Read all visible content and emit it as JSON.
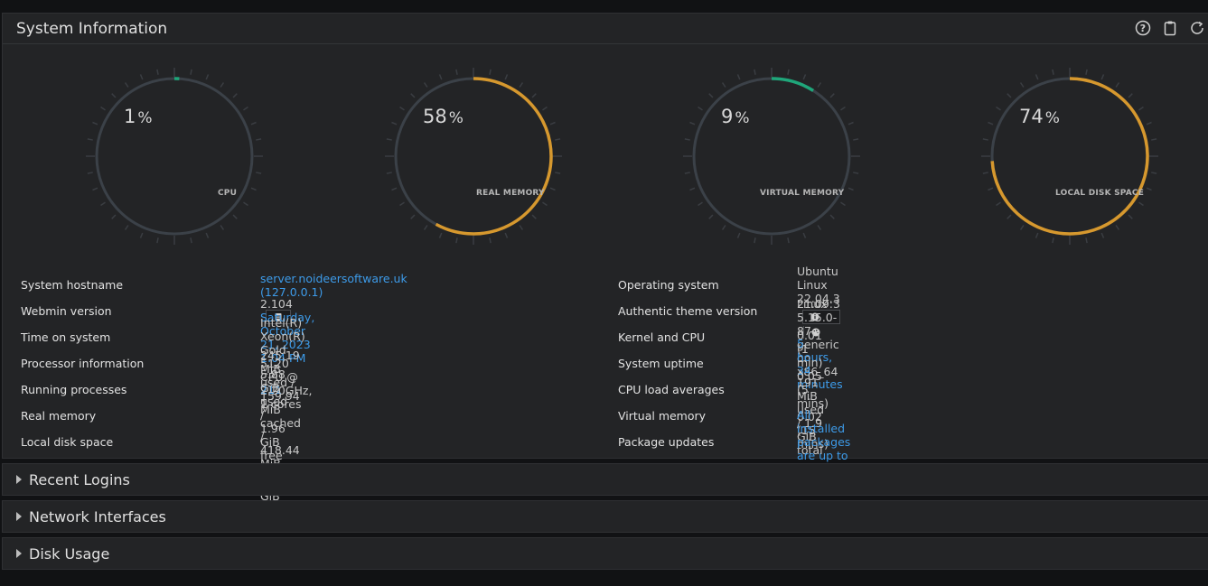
{
  "panel": {
    "title": "System Information",
    "icons": [
      "help-icon",
      "clipboard-icon",
      "refresh-icon"
    ]
  },
  "gauges": [
    {
      "id": "cpu",
      "label": "CPU",
      "value": 1,
      "color": "#1fa67a"
    },
    {
      "id": "real-memory",
      "label": "REAL MEMORY",
      "value": 58,
      "color": "#d6982e"
    },
    {
      "id": "virtual-memory",
      "label": "VIRTUAL MEMORY",
      "value": 9,
      "color": "#1fa67a"
    },
    {
      "id": "local-disk-space",
      "label": "LOCAL DISK SPACE",
      "value": 74,
      "color": "#d6982e"
    }
  ],
  "gauge_pct_symbol": "%",
  "left_info": [
    {
      "label": "System hostname",
      "value": "server.noideersoftware.uk (127.0.0.1)",
      "link": true
    },
    {
      "label": "Webmin version",
      "value": "2.104",
      "link": false
    },
    {
      "label": "Time on system",
      "value": "Saturday, October 21, 2023 1:04 PM",
      "link": true
    },
    {
      "label": "Processor information",
      "value": "Intel(R) Xeon(R) Gold 5120 CPU @ 2.20GHz, 1 cores",
      "link": false
    },
    {
      "label": "Running processes",
      "value": "211",
      "link": true
    },
    {
      "label": "Real memory",
      "value": "245.19 MiB used / 159.94 MiB cached / 418.44 MiB total",
      "link": false
    },
    {
      "label": "Local disk space",
      "value": "5.88 GiB used / 1.96 GiB free / 7.84 GiB total",
      "link": false
    }
  ],
  "right_info": [
    {
      "label": "Operating system",
      "value": "Ubuntu Linux 22.04.3",
      "link": false
    },
    {
      "label": "Authentic theme version",
      "value": "21.09:3",
      "link": false
    },
    {
      "label": "Kernel and CPU",
      "value": "Linux 5.15.0-87-generic on x86_64",
      "link": false
    },
    {
      "label": "System uptime",
      "value": "5 hours, 34 minutes",
      "link": true
    },
    {
      "label": "CPU load averages",
      "value": "0.01 (1 min) 0.05 (5 mins) 0.02 (15 mins)",
      "link": false
    },
    {
      "label": "Virtual memory",
      "value": "191 MiB used / 1.9 GiB total",
      "link": false
    },
    {
      "label": "Package updates",
      "value": "All installed packages are up to date",
      "link": true
    }
  ],
  "collapsed_panels": [
    {
      "title": "Recent Logins"
    },
    {
      "title": "Network Interfaces"
    },
    {
      "title": "Disk Usage"
    }
  ],
  "colors": {
    "link": "#3d9be9",
    "green": "#1fa67a",
    "orange": "#d6982e",
    "track": "#3b4148"
  }
}
